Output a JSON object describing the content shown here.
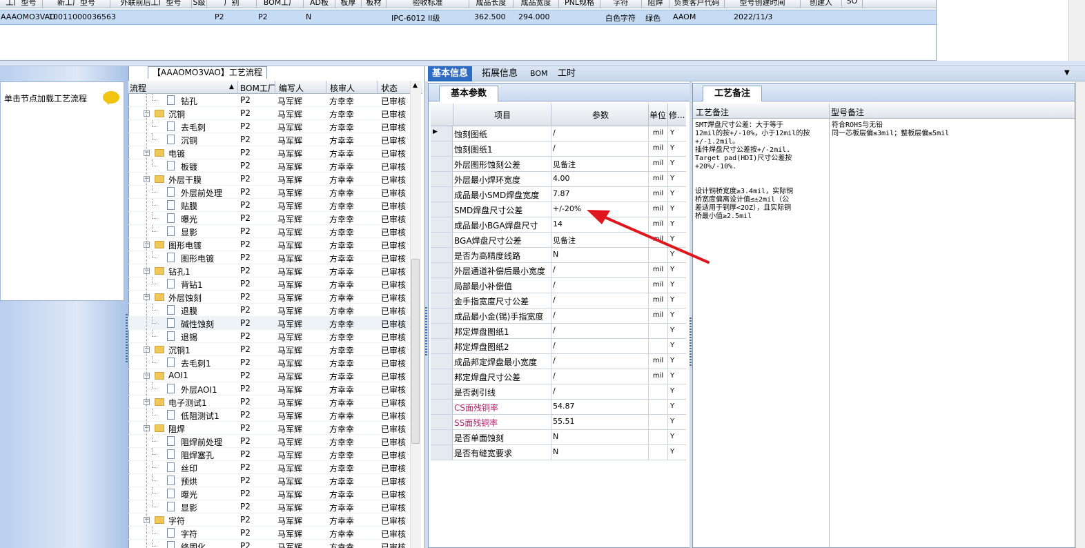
{
  "top_grid": {
    "headers": [
      "工厂型号",
      "新工厂型号",
      "外联前后工厂型号",
      "S级",
      "厂别",
      "BOM工厂",
      "AD板",
      "板厚",
      "板材",
      "验收标准",
      "成品长度",
      "成品宽度",
      "PNL规格",
      "字符",
      "阻焊",
      "负责客户代码",
      "型号创建时间",
      "创建人",
      "SO"
    ],
    "row": {
      "part_no": "AAAOMO3VAO",
      "new_no": "10011000036563",
      "f1": "P2",
      "f2": "P2",
      "f3": "N",
      "standard": "IPC-6012 II级",
      "length": "362.500",
      "width": "294.000",
      "char_color": "白色字符",
      "mask_color": "绿色",
      "customer": "AAOM",
      "created": "2022/11/3"
    }
  },
  "left_panel": {
    "hint": "单击节点加载工艺流程",
    "bubble_icon": "speech-bubble-icon"
  },
  "tree": {
    "title": "【AAAOMO3VAO】工艺流程",
    "headers": {
      "flow": "流程",
      "bom": "BOM工厂",
      "author": "编写人",
      "reviewer": "核审人",
      "status": "状态"
    },
    "rows": [
      {
        "name": "钻孔",
        "type": "doc",
        "level": 1,
        "bom": "P2",
        "author": "马军辉",
        "reviewer": "方幸幸",
        "status": "已审核"
      },
      {
        "name": "沉铜",
        "type": "folder",
        "level": 0,
        "bom": "P2",
        "author": "马军辉",
        "reviewer": "方幸幸",
        "status": "已审核"
      },
      {
        "name": "去毛刺",
        "type": "doc",
        "level": 1,
        "bom": "P2",
        "author": "马军辉",
        "reviewer": "方幸幸",
        "status": "已审核"
      },
      {
        "name": "沉铜",
        "type": "doc",
        "level": 1,
        "bom": "P2",
        "author": "马军辉",
        "reviewer": "方幸幸",
        "status": "已审核"
      },
      {
        "name": "电镀",
        "type": "folder",
        "level": 0,
        "bom": "P2",
        "author": "马军辉",
        "reviewer": "方幸幸",
        "status": "已审核"
      },
      {
        "name": "板镀",
        "type": "doc",
        "level": 1,
        "bom": "P2",
        "author": "马军辉",
        "reviewer": "方幸幸",
        "status": "已审核"
      },
      {
        "name": "外层干膜",
        "type": "folder",
        "level": 0,
        "bom": "P2",
        "author": "马军辉",
        "reviewer": "方幸幸",
        "status": "已审核"
      },
      {
        "name": "外层前处理",
        "type": "doc",
        "level": 1,
        "bom": "P2",
        "author": "马军辉",
        "reviewer": "方幸幸",
        "status": "已审核"
      },
      {
        "name": "贴膜",
        "type": "doc",
        "level": 1,
        "bom": "P2",
        "author": "马军辉",
        "reviewer": "方幸幸",
        "status": "已审核"
      },
      {
        "name": "曝光",
        "type": "doc",
        "level": 1,
        "bom": "P2",
        "author": "马军辉",
        "reviewer": "方幸幸",
        "status": "已审核"
      },
      {
        "name": "显影",
        "type": "doc",
        "level": 1,
        "bom": "P2",
        "author": "马军辉",
        "reviewer": "方幸幸",
        "status": "已审核"
      },
      {
        "name": "图形电镀",
        "type": "folder",
        "level": 0,
        "bom": "P2",
        "author": "马军辉",
        "reviewer": "方幸幸",
        "status": "已审核"
      },
      {
        "name": "图形电镀",
        "type": "doc",
        "level": 1,
        "bom": "P2",
        "author": "马军辉",
        "reviewer": "方幸幸",
        "status": "已审核"
      },
      {
        "name": "钻孔1",
        "type": "folder",
        "level": 0,
        "bom": "P2",
        "author": "马军辉",
        "reviewer": "方幸幸",
        "status": "已审核"
      },
      {
        "name": "背钻1",
        "type": "doc",
        "level": 1,
        "bom": "P2",
        "author": "马军辉",
        "reviewer": "方幸幸",
        "status": "已审核"
      },
      {
        "name": "外层蚀刻",
        "type": "folder",
        "level": 0,
        "bom": "P2",
        "author": "马军辉",
        "reviewer": "方幸幸",
        "status": "已审核"
      },
      {
        "name": "退膜",
        "type": "doc",
        "level": 1,
        "bom": "P2",
        "author": "马军辉",
        "reviewer": "方幸幸",
        "status": "已审核"
      },
      {
        "name": "碱性蚀刻",
        "type": "doc",
        "level": 1,
        "bom": "P2",
        "author": "马军辉",
        "reviewer": "方幸幸",
        "status": "已审核",
        "selected": true
      },
      {
        "name": "退锡",
        "type": "doc",
        "level": 1,
        "bom": "P2",
        "author": "马军辉",
        "reviewer": "方幸幸",
        "status": "已审核"
      },
      {
        "name": "沉铜1",
        "type": "folder",
        "level": 0,
        "bom": "P2",
        "author": "马军辉",
        "reviewer": "方幸幸",
        "status": "已审核"
      },
      {
        "name": "去毛刺1",
        "type": "doc",
        "level": 1,
        "bom": "P2",
        "author": "马军辉",
        "reviewer": "方幸幸",
        "status": "已审核"
      },
      {
        "name": "AOI1",
        "type": "folder",
        "level": 0,
        "bom": "P2",
        "author": "马军辉",
        "reviewer": "方幸幸",
        "status": "已审核"
      },
      {
        "name": "外层AOI1",
        "type": "doc",
        "level": 1,
        "bom": "P2",
        "author": "马军辉",
        "reviewer": "方幸幸",
        "status": "已审核"
      },
      {
        "name": "电子测试1",
        "type": "folder",
        "level": 0,
        "bom": "P2",
        "author": "马军辉",
        "reviewer": "方幸幸",
        "status": "已审核"
      },
      {
        "name": "低阻测试1",
        "type": "doc",
        "level": 1,
        "bom": "P2",
        "author": "马军辉",
        "reviewer": "方幸幸",
        "status": "已审核"
      },
      {
        "name": "阻焊",
        "type": "folder",
        "level": 0,
        "bom": "P2",
        "author": "马军辉",
        "reviewer": "方幸幸",
        "status": "已审核"
      },
      {
        "name": "阻焊前处理",
        "type": "doc",
        "level": 1,
        "bom": "P2",
        "author": "马军辉",
        "reviewer": "方幸幸",
        "status": "已审核"
      },
      {
        "name": "阻焊塞孔",
        "type": "doc",
        "level": 1,
        "bom": "P2",
        "author": "马军辉",
        "reviewer": "方幸幸",
        "status": "已审核"
      },
      {
        "name": "丝印",
        "type": "doc",
        "level": 1,
        "bom": "P2",
        "author": "马军辉",
        "reviewer": "方幸幸",
        "status": "已审核"
      },
      {
        "name": "预烘",
        "type": "doc",
        "level": 1,
        "bom": "P2",
        "author": "马军辉",
        "reviewer": "方幸幸",
        "status": "已审核"
      },
      {
        "name": "曝光",
        "type": "doc",
        "level": 1,
        "bom": "P2",
        "author": "马军辉",
        "reviewer": "方幸幸",
        "status": "已审核"
      },
      {
        "name": "显影",
        "type": "doc",
        "level": 1,
        "bom": "P2",
        "author": "马军辉",
        "reviewer": "方幸幸",
        "status": "已审核"
      },
      {
        "name": "字符",
        "type": "folder",
        "level": 0,
        "bom": "P2",
        "author": "马军辉",
        "reviewer": "方幸幸",
        "status": "已审核"
      },
      {
        "name": "字符",
        "type": "doc",
        "level": 1,
        "bom": "P2",
        "author": "马军辉",
        "reviewer": "方幸幸",
        "status": "已审核"
      },
      {
        "name": "终固化",
        "type": "doc",
        "level": 1,
        "bom": "P2",
        "author": "马军辉",
        "reviewer": "方幸幸",
        "status": "已审核"
      }
    ]
  },
  "tabs": [
    "基本信息",
    "拓展信息",
    "BOM",
    "工时"
  ],
  "params": {
    "tab": "基本参数",
    "headers": {
      "item": "项目",
      "value": "参数",
      "unit": "单位",
      "mod": "修..."
    },
    "rows": [
      {
        "name": "蚀刻图纸",
        "value": "/",
        "unit": "mil",
        "mod": "Y",
        "current": true
      },
      {
        "name": "蚀刻图纸1",
        "value": "/",
        "unit": "mil",
        "mod": "Y"
      },
      {
        "name": "外层图形蚀刻公差",
        "value": "见备注",
        "unit": "mil",
        "mod": "Y"
      },
      {
        "name": "外层最小焊环宽度",
        "value": "4.00",
        "unit": "mil",
        "mod": "Y"
      },
      {
        "name": "成品最小SMD焊盘宽度",
        "value": "7.87",
        "unit": "mil",
        "mod": "Y"
      },
      {
        "name": "SMD焊盘尺寸公差",
        "value": "+/-20%",
        "unit": "mil",
        "mod": "Y"
      },
      {
        "name": "成品最小BGA焊盘尺寸",
        "value": "14",
        "unit": "mil",
        "mod": "Y"
      },
      {
        "name": "BGA焊盘尺寸公差",
        "value": "见备注",
        "unit": "mil",
        "mod": "Y"
      },
      {
        "name": "是否为高精度线路",
        "value": "N",
        "unit": "",
        "mod": "Y"
      },
      {
        "name": "外层通道补偿后最小宽度",
        "value": "/",
        "unit": "mil",
        "mod": "Y"
      },
      {
        "name": "局部最小补偿值",
        "value": "/",
        "unit": "mil",
        "mod": "Y"
      },
      {
        "name": "金手指宽度尺寸公差",
        "value": "/",
        "unit": "mil",
        "mod": "Y"
      },
      {
        "name": "成品最小金(锡)手指宽度",
        "value": "/",
        "unit": "mil",
        "mod": "Y"
      },
      {
        "name": "邦定焊盘图纸1",
        "value": "/",
        "unit": "",
        "mod": "Y"
      },
      {
        "name": "邦定焊盘图纸2",
        "value": "/",
        "unit": "",
        "mod": "Y"
      },
      {
        "name": "成品邦定焊盘最小宽度",
        "value": "/",
        "unit": "mil",
        "mod": "Y"
      },
      {
        "name": "邦定焊盘尺寸公差",
        "value": "/",
        "unit": "mil",
        "mod": "Y"
      },
      {
        "name": "是否剥引线",
        "value": "/",
        "unit": "",
        "mod": "Y"
      },
      {
        "name": "CS面残铜率",
        "value": "54.87",
        "unit": "",
        "mod": "Y",
        "highlight": true
      },
      {
        "name": "SS面残铜率",
        "value": "55.51",
        "unit": "",
        "mod": "Y",
        "highlight": true
      },
      {
        "name": "是否单面蚀刻",
        "value": "N",
        "unit": "",
        "mod": "Y"
      },
      {
        "name": "是否有缝宽要求",
        "value": "N",
        "unit": "",
        "mod": "Y"
      }
    ]
  },
  "remarks": {
    "tab": "工艺备注",
    "col1_header": "工艺备注",
    "col2_header": "型号备注",
    "process_note": "SMT焊盘尺寸公差：大于等于\n12mil的按+/-10%，小于12mil的按\n+/-1.2mil。\n插件焊盘尺寸公差按+/-2mil.\nTarget pad(HDI)尺寸公差按\n+20%/-10%.\n\n\n设计铜桥宽度≥3.4mil，实际铜\n桥宽度偏离设计值≤±2mil（公\n差适用于铜厚<2OZ），且实际铜\n桥最小值≥2.5mil",
    "model_note": "符合ROHS与无铅\n同一芯板层偏≤3mil；整板层偏≤5mil"
  },
  "annotation": {
    "arrow_color": "#e0161e"
  }
}
